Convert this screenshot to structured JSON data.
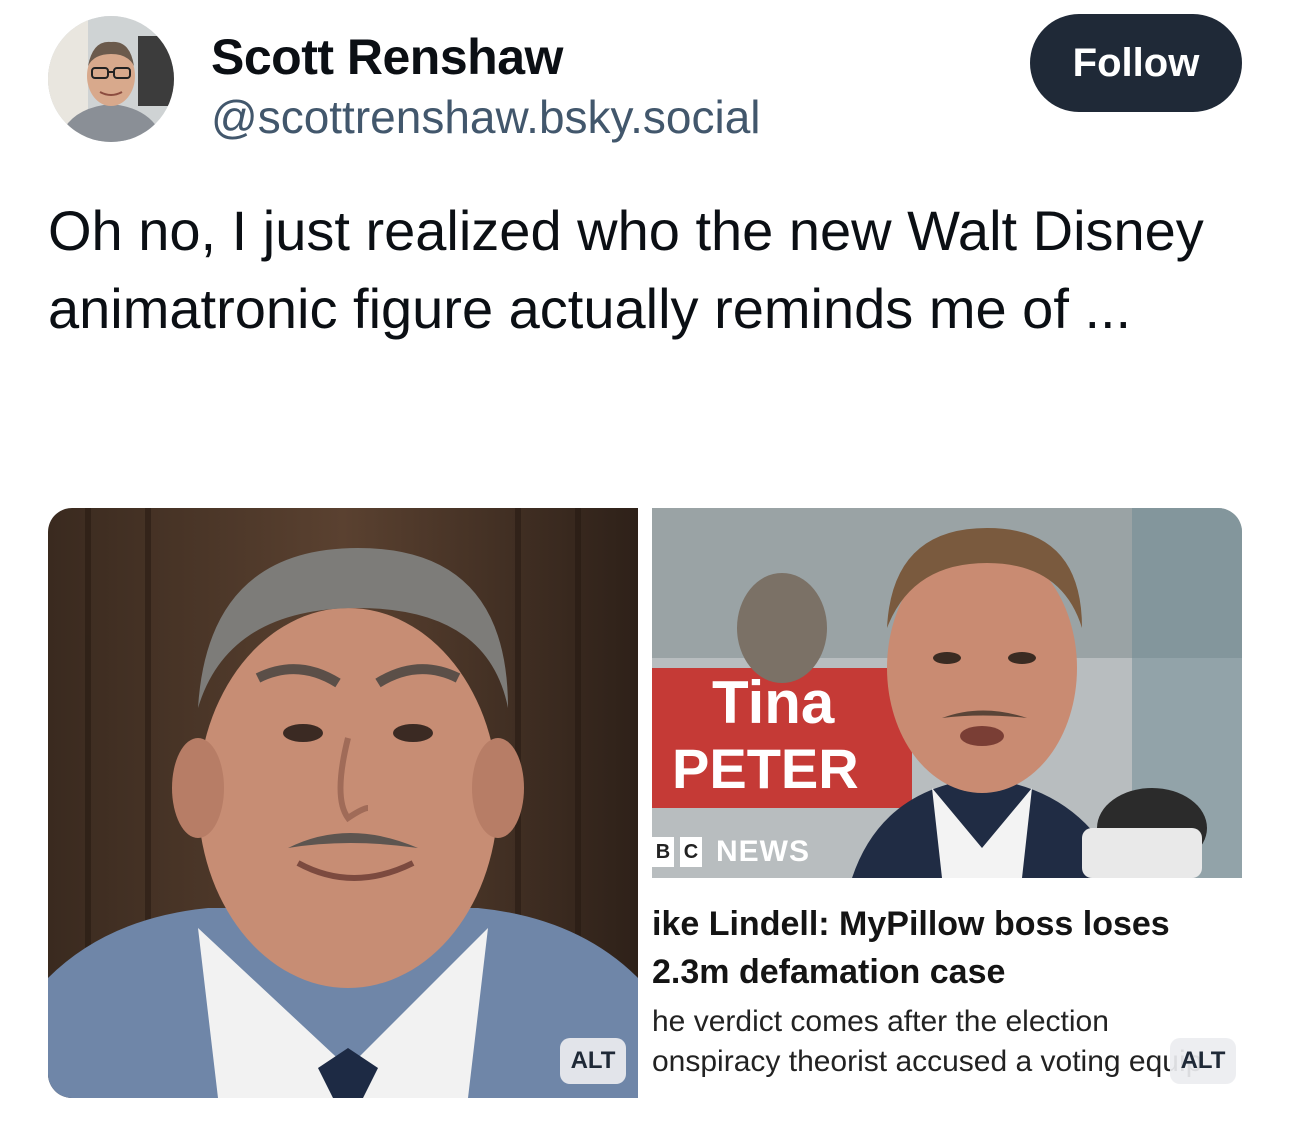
{
  "author": {
    "display_name": "Scott Renshaw",
    "handle": "@scottrenshaw.bsky.social"
  },
  "follow_label": "Follow",
  "post": {
    "text": "Oh no, I just realized who the new Walt Disney animatronic figure actually reminds me of ..."
  },
  "images": [
    {
      "alt_label": "ALT"
    },
    {
      "alt_label": "ALT",
      "sign_text_1": "Tina",
      "sign_text_2": "PETER",
      "news_brand": "NEWS",
      "news_boxes": [
        "B",
        "C"
      ],
      "headline_lines": [
        "ike Lindell: MyPillow boss loses",
        "2.3m defamation case"
      ],
      "summary_lines": [
        "he verdict comes after the election",
        "onspiracy theorist accused a voting equip"
      ]
    }
  ],
  "colors": {
    "follow_bg": "#1f2937",
    "handle": "#42576c",
    "text": "#0b0f14"
  }
}
